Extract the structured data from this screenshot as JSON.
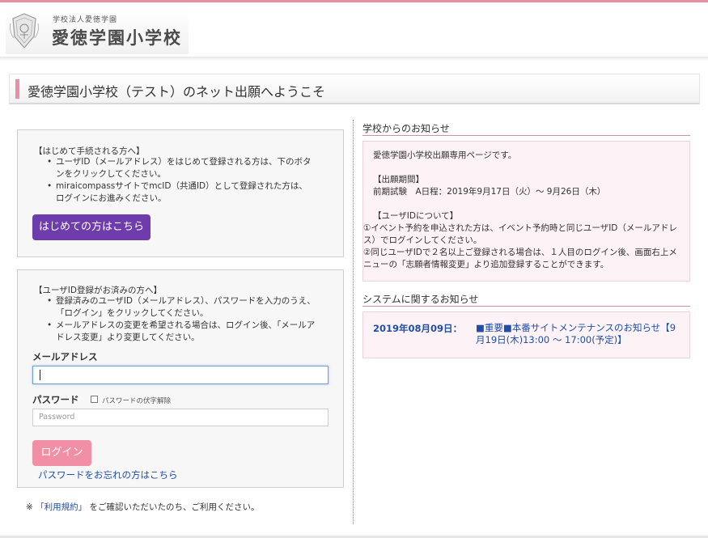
{
  "header": {
    "school_corp": "学校法人愛徳学園",
    "school_name": "愛徳学園小学校"
  },
  "title": "愛徳学園小学校（テスト）のネット出願へようこそ",
  "first_time": {
    "heading": "【はじめて手続される方へ】",
    "bullets": [
      "ユーザID（メールアドレス）をはじめて登録される方は、下のボタンをクリックしてください。",
      "miraicompassサイトでmcID（共通ID）として登録された方は、ログインにお進みください。"
    ],
    "button_label": "はじめての方はこちら"
  },
  "login": {
    "heading": "【ユーザID登録がお済みの方へ】",
    "bullets": [
      "登録済みのユーザID（メールアドレス）、パスワードを入力のうえ、「ログイン」をクリックしてください。",
      "メールアドレスの変更を希望される場合は、ログイン後、「メールアドレス変更」より変更してください。"
    ],
    "email_label": "メールアドレス",
    "email_value": "",
    "password_label": "パスワード",
    "show_password_label": "パスワードの伏字解除",
    "password_placeholder": "Password",
    "login_button": "ログイン",
    "forgot_link": "パスワードをお忘れの方はこちら"
  },
  "terms": {
    "prefix": "※",
    "link": "「利用規約」",
    "suffix": "をご確認いただいたのち、ご利用ください。"
  },
  "school_notice": {
    "title": "学校からのお知らせ",
    "lines": [
      "愛徳学園小学校出願専用ページです。",
      "",
      "【出願期間】",
      "前期試験　A日程：2019年9月17日（火）～ 9月26日（木）",
      "",
      "【ユーザIDについて】",
      "①イベント予約を申込された方は、イベント予約時と同じユーザID（メールアドレス）でログインしてください。",
      "②同じユーザIDで２名以上ご登録される場合は、１人目のログイン後、画面右上メニューの「志願者情報変更」より追加登録することができます。"
    ]
  },
  "system_notice": {
    "title": "システムに関するお知らせ",
    "date": "2019年08月09日：",
    "link": "■重要■本番サイトメンテナンスのお知らせ【9月19日(木)13:00 ～ 17:00(予定)】"
  },
  "colors": {
    "accent_pink": "#e98ea4",
    "purple_button": "#6f3dab",
    "login_button": "#f08fa6",
    "link_blue": "#1f4ea8"
  }
}
